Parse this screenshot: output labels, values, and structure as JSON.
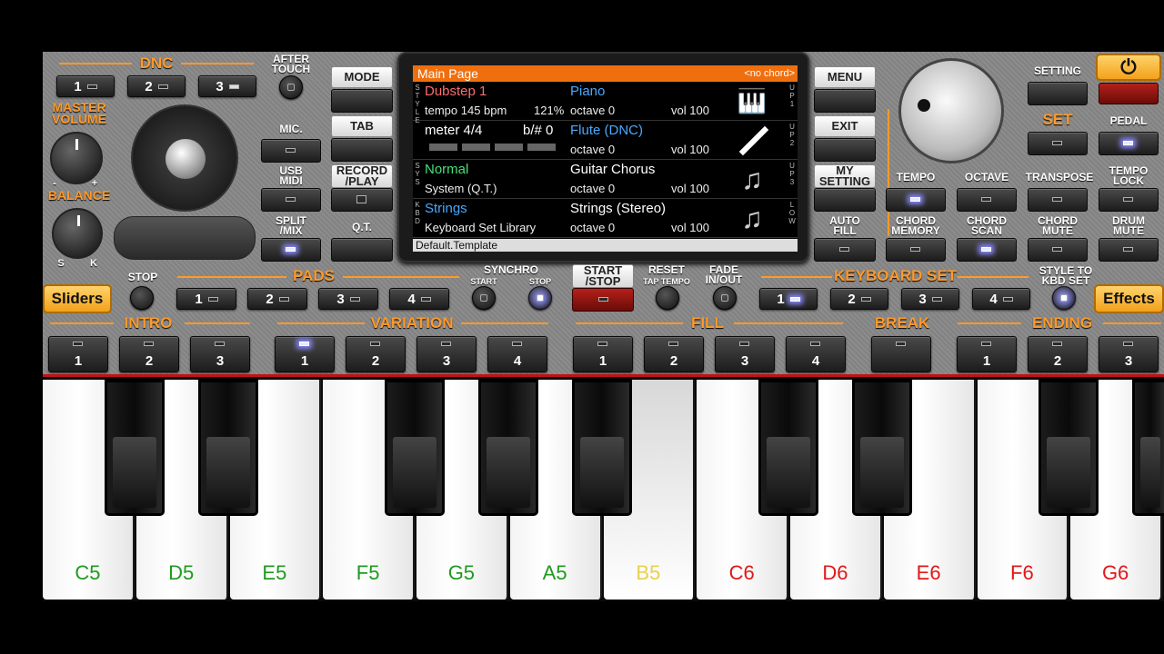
{
  "panel": {
    "dnc": {
      "title": "DNC",
      "buttons": [
        "1",
        "2",
        "3"
      ]
    },
    "after_touch": "AFTER\nTOUCH",
    "master_volume": "MASTER\nVOLUME",
    "balance": {
      "title": "BALANCE",
      "left": "S",
      "right": "K",
      "minus": "-",
      "plus": "+"
    },
    "mic": "MIC.",
    "usb_midi": "USB\nMIDI",
    "split_mix": "SPLIT\n/MIX",
    "mode": "MODE",
    "tab": "TAB",
    "record_play": "RECORD\n/PLAY",
    "qt": "Q.T.",
    "menu": "MENU",
    "exit": "EXIT",
    "my_setting": "MY\nSETTING",
    "auto_fill": "AUTO\nFILL",
    "setting": "SETTING",
    "set": "SET",
    "pedal": "PEDAL",
    "power_icon": "power-icon",
    "tempo": "TEMPO",
    "octave": "OCTAVE",
    "transpose": "TRANSPOSE",
    "tempo_lock": "TEMPO\nLOCK",
    "chord_memory": "CHORD\nMEMORY",
    "chord_scan": "CHORD\nSCAN",
    "chord_mute": "CHORD\nMUTE",
    "drum_mute": "DRUM\nMUTE",
    "sliders": "Sliders",
    "effects": "Effects",
    "stop": "STOP",
    "pads": {
      "title": "PADS",
      "buttons": [
        "1",
        "2",
        "3",
        "4"
      ]
    },
    "synchro": {
      "title": "SYNCHRO",
      "start": "START",
      "stop": "STOP"
    },
    "start_stop": "START\n/STOP",
    "reset": "RESET",
    "tap_tempo": "TAP TEMPO",
    "fade": "FADE\nIN/OUT",
    "keyboard_set": {
      "title": "KEYBOARD SET",
      "buttons": [
        "1",
        "2",
        "3",
        "4"
      ]
    },
    "style_to_kbd": "STYLE TO\nKBD SET",
    "intro": {
      "title": "INTRO",
      "buttons": [
        "1",
        "2",
        "3"
      ]
    },
    "variation": {
      "title": "VARIATION",
      "buttons": [
        "1",
        "2",
        "3",
        "4"
      ]
    },
    "fill": {
      "title": "FILL",
      "buttons": [
        "1",
        "2",
        "3",
        "4"
      ]
    },
    "break": "BREAK",
    "ending": {
      "title": "ENDING",
      "buttons": [
        "1",
        "2",
        "3"
      ]
    }
  },
  "screen": {
    "title": "Main Page",
    "chord": "<no chord>",
    "style": {
      "name": "Dubstep 1",
      "tempo": "tempo 145 bpm",
      "percent": "121%",
      "meter": "meter 4/4",
      "key": "b/# 0"
    },
    "sys": {
      "name": "Normal",
      "sub": "System (Q.T.)"
    },
    "kbd": {
      "name": "Strings",
      "sub": "Keyboard Set Library"
    },
    "side_left": [
      "STYLE",
      "SYS",
      "KBD"
    ],
    "side_right": [
      "UP1",
      "UP2",
      "UP3",
      "LOW"
    ],
    "parts": [
      {
        "name": "Piano",
        "octave": "octave 0",
        "vol": "vol 100",
        "icon": "piano-icon"
      },
      {
        "name": "Flute (DNC)",
        "octave": "octave 0",
        "vol": "vol 100",
        "icon": "flute-icon"
      },
      {
        "name": "Guitar Chorus",
        "octave": "octave 0",
        "vol": "vol 100",
        "icon": "music-note-icon"
      },
      {
        "name": "Strings (Stereo)",
        "octave": "octave 0",
        "vol": "vol 100",
        "icon": "music-note-icon"
      }
    ],
    "footer": "Default.Template"
  },
  "keyboard": {
    "white_keys": [
      {
        "note": "C5",
        "color": "#1f9a1f"
      },
      {
        "note": "D5",
        "color": "#1f9a1f"
      },
      {
        "note": "E5",
        "color": "#1f9a1f"
      },
      {
        "note": "F5",
        "color": "#1f9a1f"
      },
      {
        "note": "G5",
        "color": "#1f9a1f"
      },
      {
        "note": "A5",
        "color": "#1f9a1f"
      },
      {
        "note": "B5",
        "color": "#e8d24a"
      },
      {
        "note": "C6",
        "color": "#e01818"
      },
      {
        "note": "D6",
        "color": "#e01818"
      },
      {
        "note": "E6",
        "color": "#e01818"
      },
      {
        "note": "F6",
        "color": "#e01818"
      },
      {
        "note": "G6",
        "color": "#e01818"
      }
    ]
  }
}
